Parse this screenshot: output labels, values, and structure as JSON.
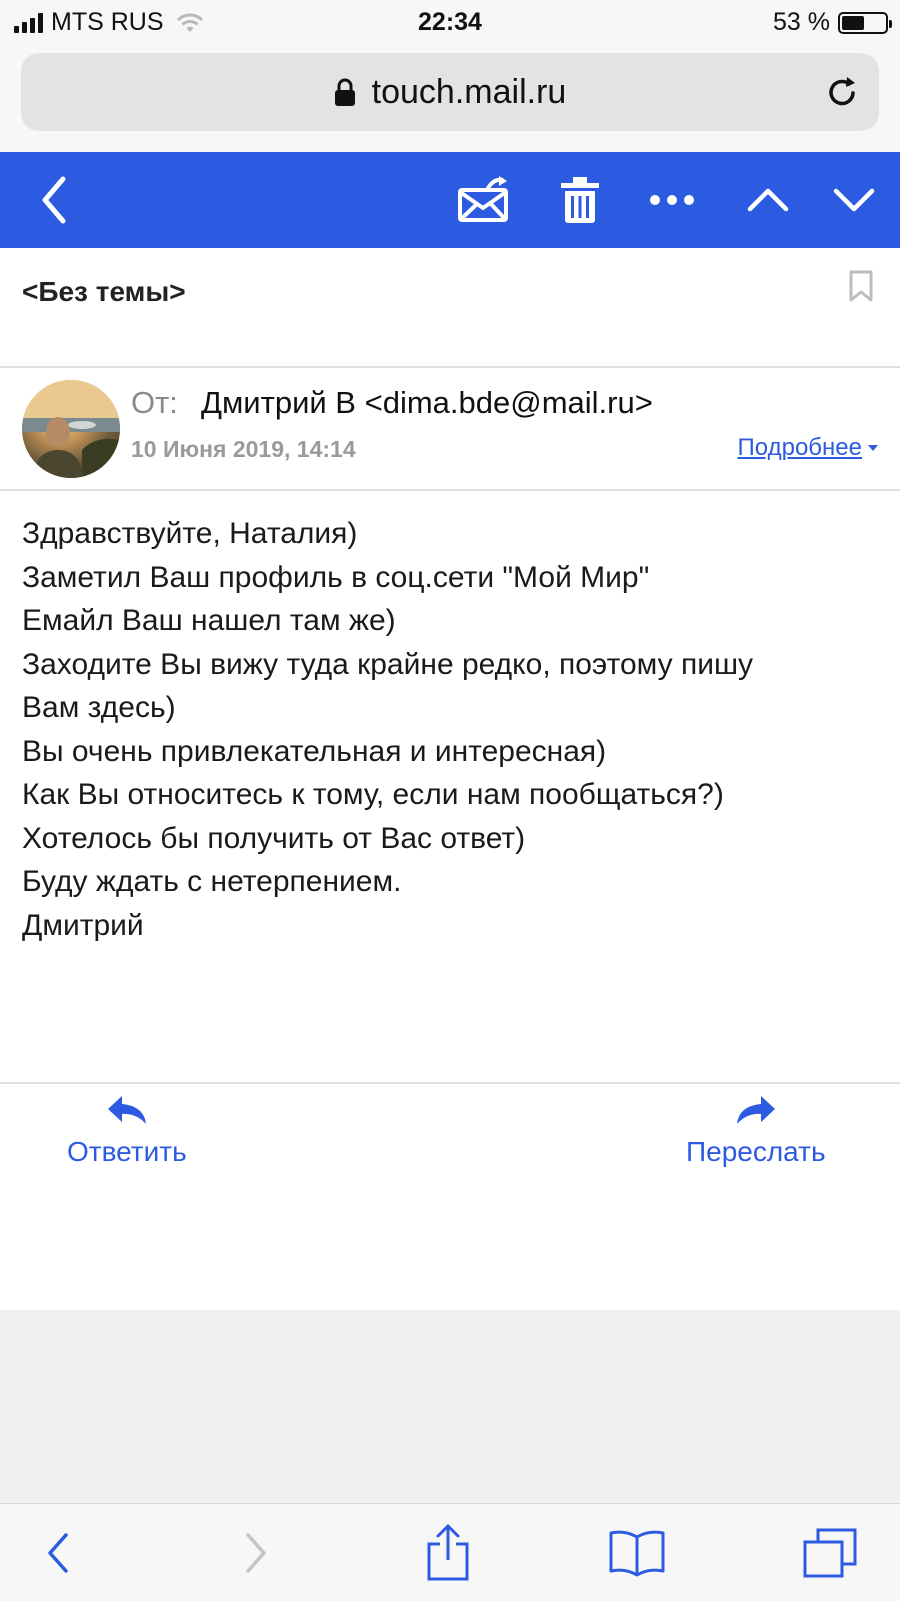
{
  "status": {
    "carrier": "MTS RUS",
    "time": "22:34",
    "battery": "53 %",
    "battery_level": 0.53
  },
  "browser": {
    "url": "touch.mail.ru"
  },
  "toolbar": {
    "icons": [
      "back-chevron-icon",
      "spam-envelope-icon",
      "trash-icon",
      "more-dots-icon",
      "chevron-up-icon",
      "chevron-down-icon"
    ],
    "color": "#2c5be2"
  },
  "email": {
    "subject": "<Без темы>",
    "from_label": "От:",
    "from": "Дмитрий В <dima.bde@mail.ru>",
    "date": "10 Июня 2019, 14:14",
    "details_link": "Подробнее",
    "body": [
      "Здравствуйте, Наталия)",
      "Заметил Ваш профиль в соц.сети \"Мой Мир\"",
      "Емайл Ваш нашел там же)",
      "Заходите Вы вижу туда крайне редко, поэтому пишу",
      "Вам здесь)",
      "Вы очень привлекательная и интересная)",
      "Как Вы относитесь к тому, если нам пообщаться?)",
      "Хотелось бы получить от Вас ответ)",
      "Буду ждать с нетерпением.",
      "Дмитрий"
    ]
  },
  "actions": {
    "reply": "Ответить",
    "forward": "Переслать"
  },
  "safari_bar": {
    "icons": [
      "back-icon",
      "forward-icon",
      "share-icon",
      "bookmarks-icon",
      "tabs-icon"
    ]
  }
}
